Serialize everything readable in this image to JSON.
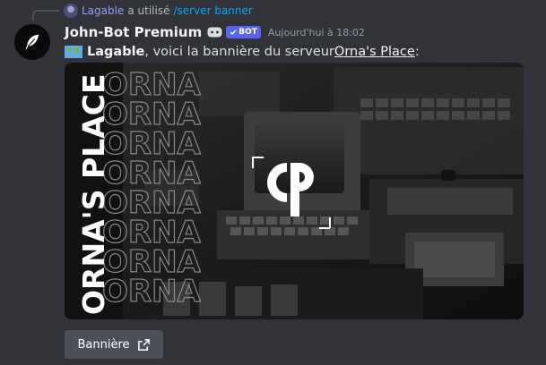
{
  "reply": {
    "user": "Lagable",
    "action": "a utilisé",
    "command": "/server banner"
  },
  "message": {
    "author": "John-Bot Premium",
    "bot_tag": "BOT",
    "timestamp": "Aujourd'hui à 18:02",
    "mention": "Lagable",
    "text_middle": ", voici la bannière du serveur ",
    "server_name": "Orna's Place",
    "text_end": " :"
  },
  "banner": {
    "vertical_title": "ORNA'S PLACE",
    "repeat_word": "ORNA",
    "logo_letters": "OP"
  },
  "button": {
    "label": "Bannière",
    "icon": "external-link-icon"
  },
  "colors": {
    "background": "#313338",
    "username": "#f2f3f5",
    "reply_user": "#949cf7",
    "command": "#00a8fc",
    "bot_tag": "#5865f2",
    "button": "#4e5058"
  }
}
